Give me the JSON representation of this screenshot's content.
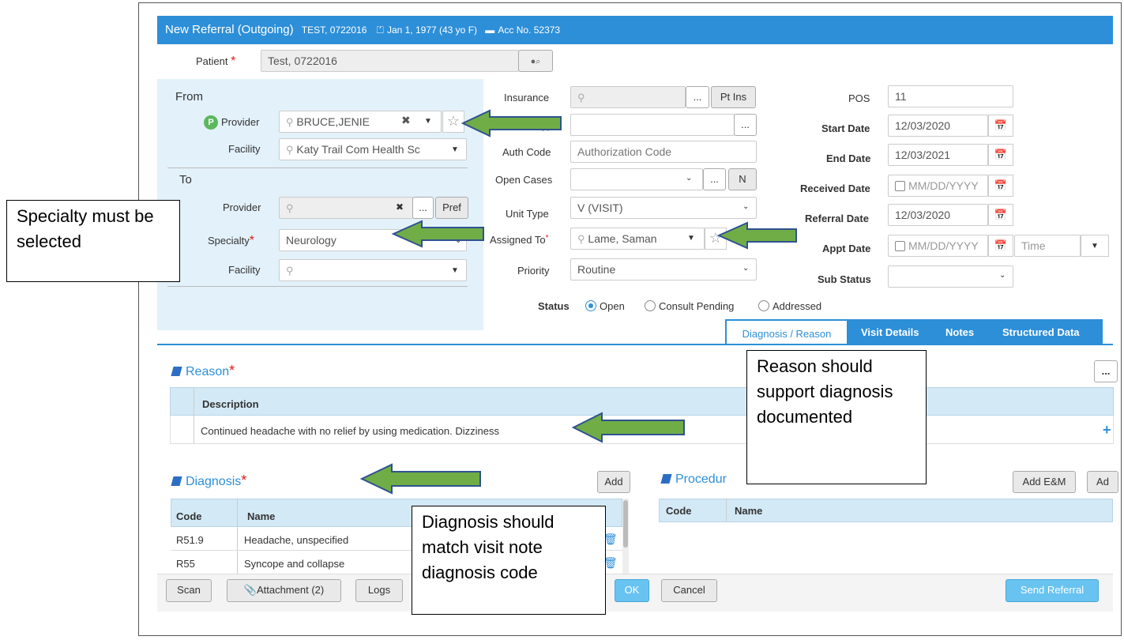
{
  "title": {
    "main": "New Referral (Outgoing)",
    "patient_name": "TEST, 0722016",
    "dob": "Jan 1, 1977 (43 yo F)",
    "acc": "Acc No. 52373"
  },
  "patient": {
    "label": "Patient",
    "value": "Test, 0722016"
  },
  "from": {
    "heading": "From",
    "provider_label": "Provider",
    "provider_badge": "P",
    "provider_value": "BRUCE,JENIE",
    "facility_label": "Facility",
    "facility_value": "Katy Trail Com Health Sc"
  },
  "to": {
    "heading": "To",
    "provider_label": "Provider",
    "pref_button": "Pref",
    "specialty_label": "Specialty",
    "specialty_value": "Neurology",
    "facility_label": "Facility"
  },
  "middle": {
    "insurance_label": "Insurance",
    "pt_ins_button": "Pt Ins",
    "type_label_partial": "ype",
    "auth_code_label": "Auth Code",
    "auth_code_placeholder": "Authorization Code",
    "open_cases_label": "Open Cases",
    "open_cases_button": "N",
    "unit_type_label": "Unit Type",
    "unit_type_value": "V (VISIT)",
    "assigned_to_label": "Assigned To",
    "assigned_to_value": "Lame, Saman",
    "priority_label": "Priority",
    "priority_value": "Routine"
  },
  "right": {
    "pos_label": "POS",
    "pos_value": "11",
    "start_date_label": "Start Date",
    "start_date_value": "12/03/2020",
    "end_date_label": "End Date",
    "end_date_value": "12/03/2021",
    "received_date_label": "Received Date",
    "received_date_placeholder": "MM/DD/YYYY",
    "referral_date_label": "Referral Date",
    "referral_date_value": "12/03/2020",
    "appt_date_label": "Appt Date",
    "appt_date_placeholder": "MM/DD/YYYY",
    "appt_time_placeholder": "Time",
    "sub_status_label": "Sub Status"
  },
  "status": {
    "label": "Status",
    "options": [
      "Open",
      "Consult Pending",
      "Addressed"
    ],
    "selected": "Open"
  },
  "tabs": [
    "Diagnosis / Reason",
    "Visit Details",
    "Notes",
    "Structured Data"
  ],
  "reason": {
    "heading": "Reason",
    "column": "Description",
    "text": "Continued headache with no relief by using medication. Dizziness"
  },
  "diagnosis": {
    "heading": "Diagnosis",
    "add_button": "Add",
    "columns": [
      "Code",
      "Name"
    ],
    "rows": [
      {
        "code": "R51.9",
        "name": "Headache, unspecified"
      },
      {
        "code": "R55",
        "name": "Syncope and collapse"
      }
    ]
  },
  "procedure": {
    "heading_partial": "Procedur",
    "add_em_button": "Add E&M",
    "add_button_partial": "Ad",
    "columns": [
      "Code",
      "Name"
    ]
  },
  "bottom_buttons": {
    "scan": "Scan",
    "attachment": "Attachment (2)",
    "logs": "Logs",
    "ok": "OK",
    "cancel": "Cancel",
    "send_referral": "Send Referral"
  },
  "annotations": {
    "specialty_note": "Specialty must be selected",
    "reason_note": "Reason should support diagnosis documented",
    "diagnosis_note": "Diagnosis should match visit note diagnosis code"
  },
  "colors": {
    "header_blue": "#2d8fd8",
    "panel_blue": "#e3f1fa",
    "arrow_green": "#70ad47",
    "arrow_border": "#2f528f"
  }
}
